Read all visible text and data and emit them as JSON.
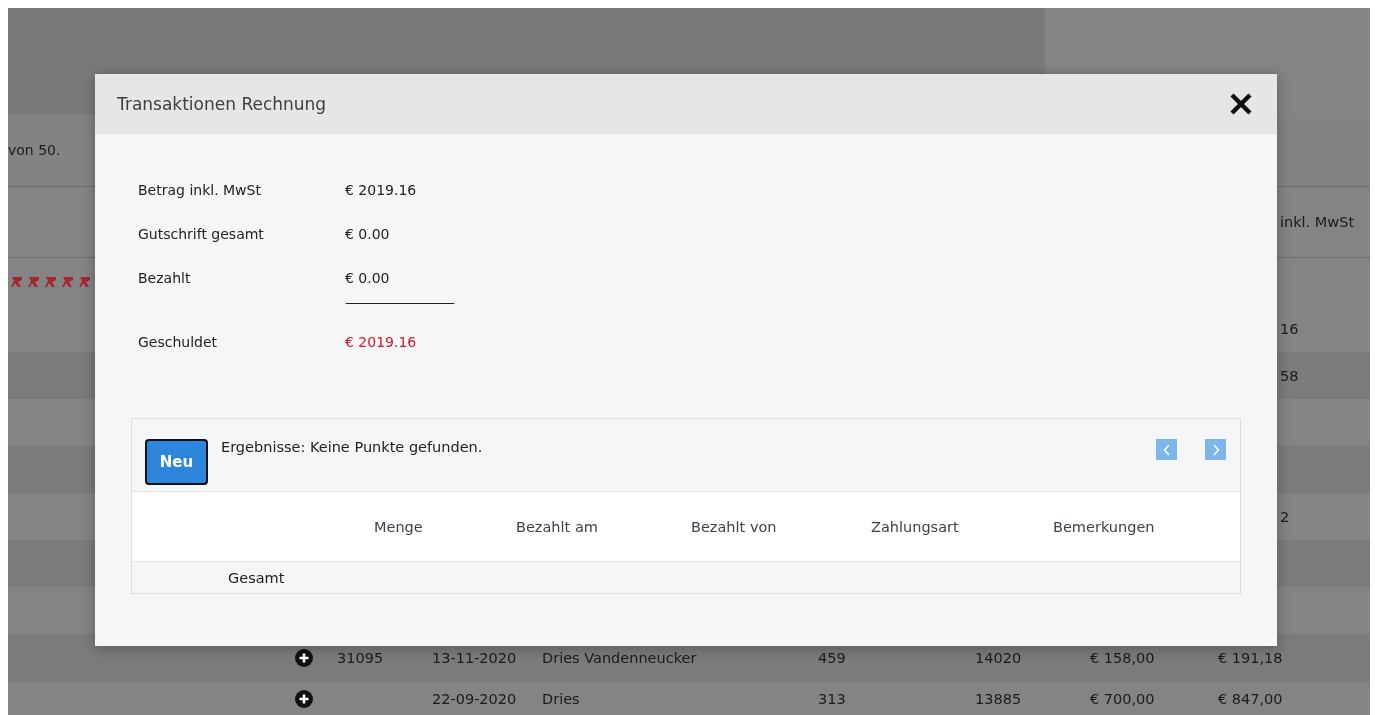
{
  "background_page": {
    "status_text": "von 50.",
    "header_cell": "inkl. MwSt",
    "rows": [
      {
        "tail": "16"
      },
      {
        "tail": "58"
      },
      {},
      {},
      {
        "tail": "2"
      },
      {},
      {},
      {
        "expandable": true,
        "id": "31095",
        "date": "13-11-2020",
        "customer": "Dries Vandenneucker",
        "column_5": "459",
        "column_6": "14020",
        "net": "€ 158,00",
        "gross": "€ 191,18"
      },
      {
        "expandable": true,
        "date": "22-09-2020",
        "customer": "Dries",
        "column_5": "313",
        "column_6": "13885",
        "net": "€ 700,00",
        "gross": "€ 847,00"
      }
    ]
  },
  "dialog": {
    "title": "Transaktionen Rechnung",
    "summary": [
      {
        "label": "Betrag inkl. MwSt",
        "value": "€ 2019.16",
        "kind": "normal"
      },
      {
        "label": "Gutschrift gesamt",
        "value": "€ 0.00",
        "kind": "normal"
      },
      {
        "label": "Bezahlt",
        "value": "€ 0.00",
        "kind": "normal"
      },
      {
        "kind": "rule",
        "value": "—————————"
      },
      {
        "label": "Geschuldet",
        "value": "€ 2019.16",
        "kind": "due"
      }
    ],
    "new_button": "Neu",
    "results_text": "Ergebnisse: Keine Punkte gefunden.",
    "table": {
      "columns": [
        "Menge",
        "Bezahlt am",
        "Bezahlt von",
        "Zahlungsart",
        "Bemerkungen"
      ],
      "footer_label": "Gesamt"
    }
  }
}
